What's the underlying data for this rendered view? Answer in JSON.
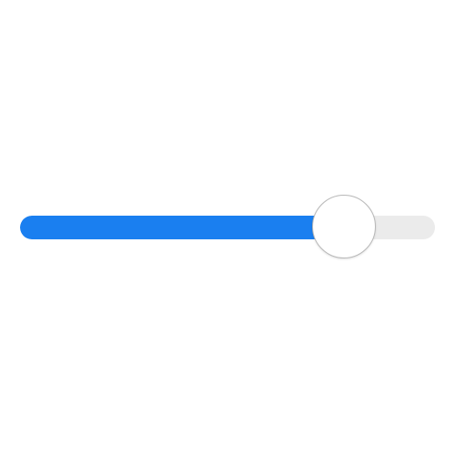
{
  "slider": {
    "value_fraction": 0.78,
    "fill_color": "#1a7ff0",
    "track_color": "#ebebeb",
    "thumb_color": "#ffffff"
  }
}
